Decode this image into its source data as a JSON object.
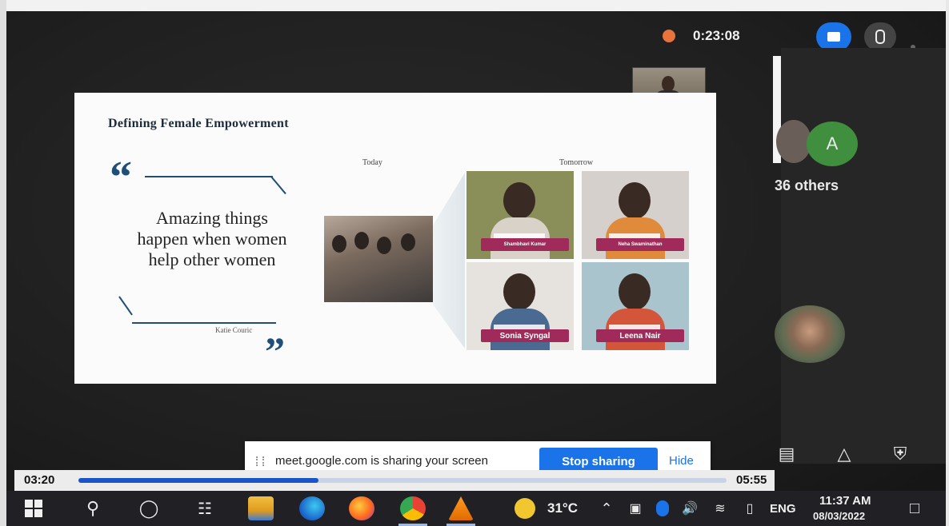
{
  "meet": {
    "timer": "0:23:08",
    "others_label": "36 others",
    "avatar_letter": "A"
  },
  "slide": {
    "title": "Defining Female Empowerment",
    "quote_open": "“",
    "quote_close": "”",
    "quote": "Amazing things happen when women help other women",
    "quote_author": "Katie Couric",
    "label_today": "Today",
    "label_tomorrow": "Tomorrow",
    "tiles": [
      {
        "name": "Shambhavi Kumar",
        "torso_color": "#d8d2c8",
        "bg": "#8a8f5a"
      },
      {
        "name": "Neha Swaminathan",
        "torso_color": "#e08a3c",
        "bg": "#d6d0cc"
      },
      {
        "name": "Sonia Syngal",
        "torso_color": "#4a6a92",
        "bg": "#e6e2de"
      },
      {
        "name": "Leena Nair",
        "torso_color": "#d4563a",
        "bg": "#a9c4cc"
      }
    ]
  },
  "share_banner": {
    "message": "meet.google.com is sharing your screen",
    "stop_label": "Stop sharing",
    "hide_label": "Hide"
  },
  "player": {
    "elapsed": "03:20",
    "remaining": "05:55",
    "progress": 0.37
  },
  "taskbar": {
    "temperature": "31°C",
    "language": "ENG",
    "time": "11:37 AM",
    "date": "08/03/2022"
  },
  "colors": {
    "accent": "#1a73e8",
    "quote_blue": "#1f4e79",
    "nameplate": "#a02a5a",
    "recording": "#e8743b"
  },
  "icons": [
    "windows-icon",
    "search-icon",
    "cortana-icon",
    "task-view-icon",
    "file-explorer-icon",
    "edge-icon",
    "firefox-icon",
    "chrome-icon",
    "vlc-icon",
    "weather-icon",
    "chevron-up-icon",
    "meet-now-icon",
    "bluetooth-icon",
    "volume-icon",
    "wifi-icon",
    "battery-icon",
    "notification-icon",
    "chat-icon",
    "activities-icon",
    "host-controls-icon"
  ]
}
